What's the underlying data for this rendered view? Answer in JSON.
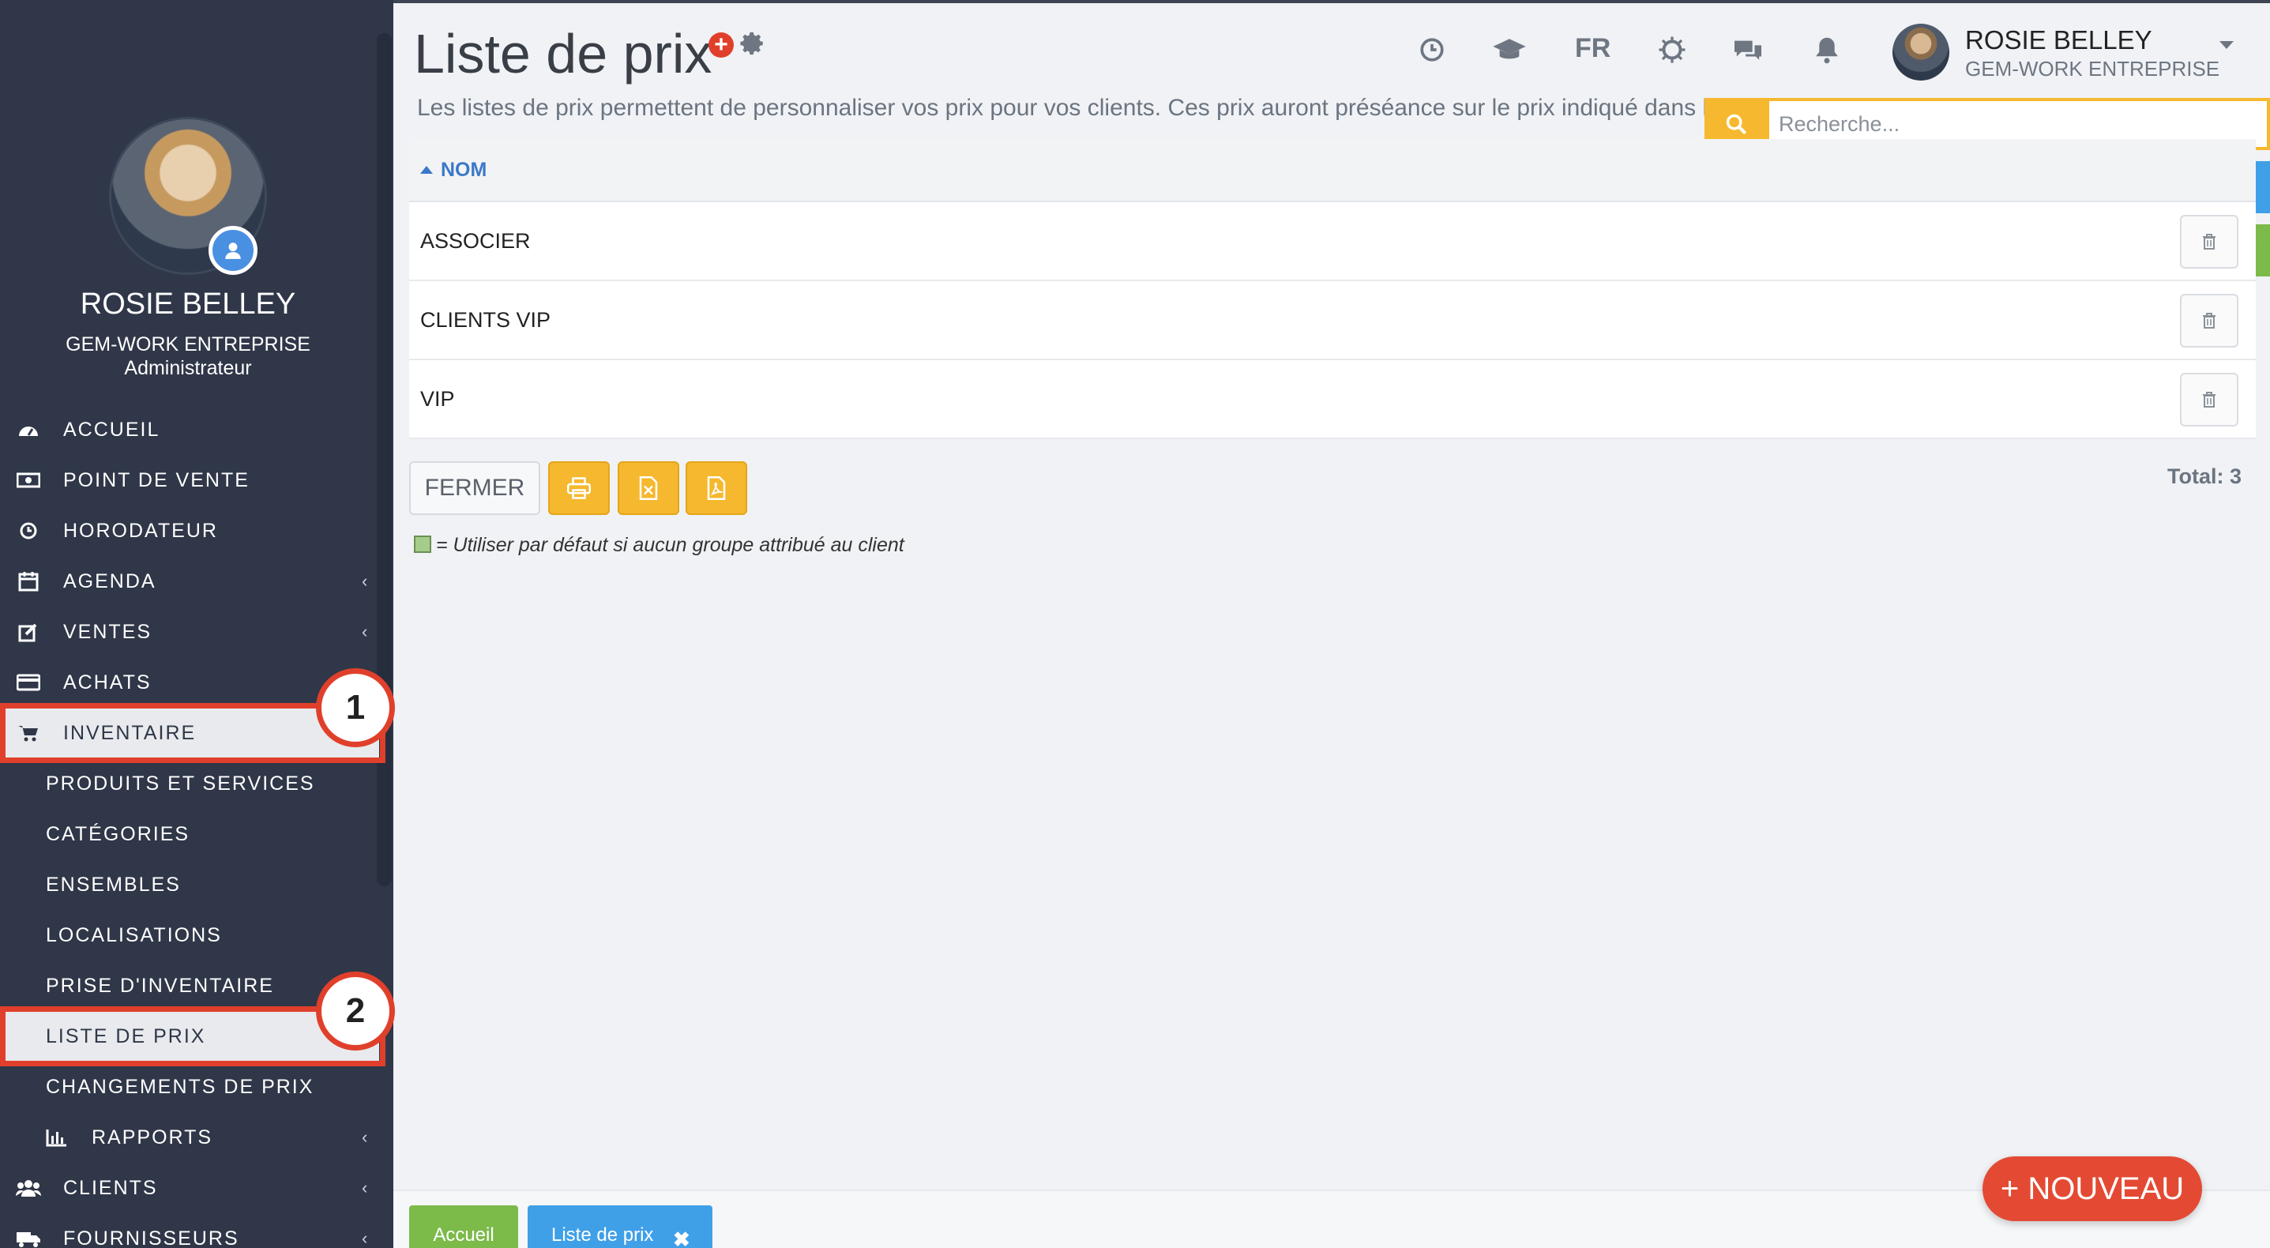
{
  "sidebar": {
    "user_name": "ROSIE BELLEY",
    "company": "GEM-WORK ENTREPRISE",
    "role": "Administrateur",
    "items": [
      {
        "label": "ACCUEIL",
        "icon": "dashboard-icon"
      },
      {
        "label": "POINT DE VENTE",
        "icon": "cash-register-icon"
      },
      {
        "label": "HORODATEUR",
        "icon": "clock-icon"
      },
      {
        "label": "AGENDA",
        "icon": "calendar-icon"
      },
      {
        "label": "VENTES",
        "icon": "edit-icon"
      },
      {
        "label": "ACHATS",
        "icon": "credit-card-icon"
      },
      {
        "label": "INVENTAIRE",
        "icon": "cart-icon"
      },
      {
        "label": "PRODUITS ET SERVICES"
      },
      {
        "label": "CATÉGORIES"
      },
      {
        "label": "ENSEMBLES"
      },
      {
        "label": "LOCALISATIONS"
      },
      {
        "label": "PRISE D'INVENTAIRE"
      },
      {
        "label": "LISTE DE PRIX"
      },
      {
        "label": "CHANGEMENTS DE PRIX"
      },
      {
        "label": "RAPPORTS",
        "icon": "bar-chart-icon"
      },
      {
        "label": "CLIENTS",
        "icon": "users-icon"
      },
      {
        "label": "FOURNISSEURS",
        "icon": "truck-icon"
      }
    ],
    "highlights": [
      "1",
      "2"
    ]
  },
  "header": {
    "title": "Liste de prix",
    "subtitle": "Les listes de prix permettent de personnaliser vos prix pour vos clients. Ces prix auront préséance sur le prix indiqué dans la fiche produit.",
    "language": "FR",
    "user_name": "ROSIE BELLEY",
    "user_company": "GEM-WORK ENTREPRISE"
  },
  "search": {
    "placeholder": "Recherche..."
  },
  "table": {
    "column_header": "NOM",
    "rows": [
      "ASSOCIER",
      "CLIENTS VIP",
      "VIP"
    ]
  },
  "actions": {
    "close_label": "FERMER",
    "total": "Total: 3"
  },
  "legend": {
    "text": "= Utiliser par défaut si aucun groupe attribué au client",
    "color": "#a5cc8a"
  },
  "bottom": {
    "home_tab": "Accueil",
    "current_tab": "Liste de prix",
    "new_button": "+ NOUVEAU"
  },
  "colors": {
    "sidebar": "#2f3748",
    "accent_yellow": "#f5b82e",
    "accent_blue": "#3fa0e8",
    "accent_green": "#7cba4a",
    "highlight_red": "#e0402b",
    "new_button": "#e44a33"
  }
}
